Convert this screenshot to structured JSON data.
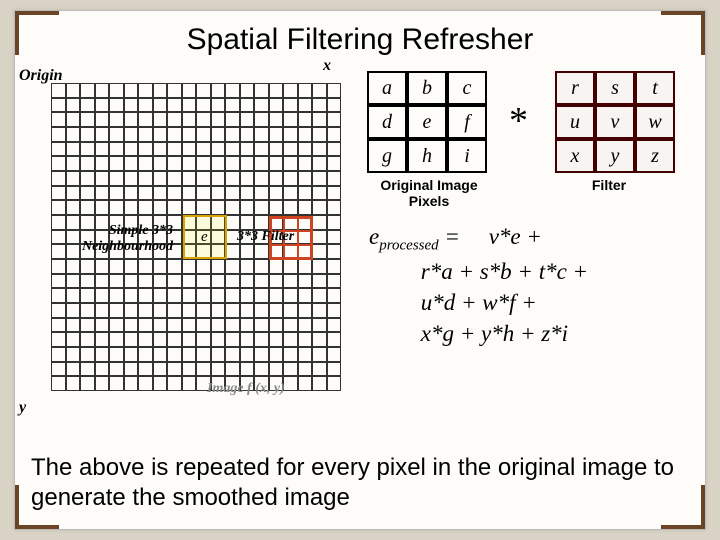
{
  "title": "Spatial Filtering Refresher",
  "labels": {
    "origin": "Origin",
    "x": "x",
    "y": "y",
    "neigh": "Simple 3*3 Neighbourhood",
    "e_center": "e",
    "filter33": "3*3 Filter",
    "image_fx_y": "Image f (x, y)",
    "orig_pixels": "Original Image Pixels",
    "filter": "Filter",
    "star": "*"
  },
  "matrix1": {
    "r0c0": "a",
    "r0c1": "b",
    "r0c2": "c",
    "r1c0": "d",
    "r1c1": "e",
    "r1c2": "f",
    "r2c0": "g",
    "r2c1": "h",
    "r2c2": "i"
  },
  "matrix2": {
    "r0c0": "r",
    "r0c1": "s",
    "r0c2": "t",
    "r1c0": "u",
    "r1c1": "v",
    "r1c2": "w",
    "r2c0": "x",
    "r2c1": "y",
    "r2c2": "z"
  },
  "formula": {
    "lhs_e": "e",
    "lhs_sub": "processed",
    "eq": " = ",
    "line1": "v*e +",
    "line2": "r*a + s*b + t*c +",
    "line3": "u*d + w*f +",
    "line4": "x*g + y*h + z*i"
  },
  "bottom": "The above is repeated for every pixel in the original image to generate the smoothed image"
}
